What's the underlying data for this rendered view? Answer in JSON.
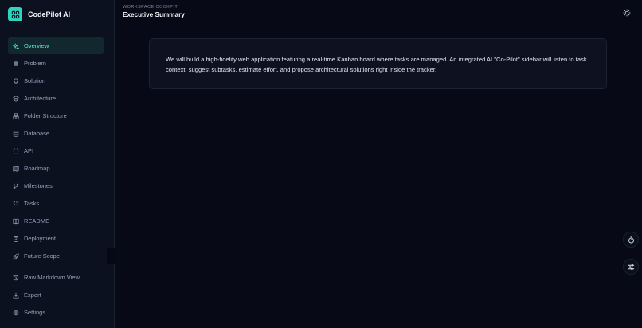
{
  "app": {
    "name": "CodePilot AI",
    "logo_icon": "grid-icon",
    "accent_color": "#2dd4bf"
  },
  "sidebar": {
    "items": [
      {
        "label": "Overview",
        "icon": "sparkles-icon",
        "active": true
      },
      {
        "label": "Problem",
        "icon": "circle-icon",
        "active": false
      },
      {
        "label": "Solution",
        "icon": "lightbulb-icon",
        "active": false
      },
      {
        "label": "Architecture",
        "icon": "layers-icon",
        "active": false
      },
      {
        "label": "Folder Structure",
        "icon": "boxes-icon",
        "active": false
      },
      {
        "label": "Database",
        "icon": "database-icon",
        "active": false
      },
      {
        "label": "API",
        "icon": "braces-icon",
        "active": false
      },
      {
        "label": "Roadmap",
        "icon": "map-icon",
        "active": false
      },
      {
        "label": "Milestones",
        "icon": "git-branch-icon",
        "active": false
      },
      {
        "label": "Tasks",
        "icon": "list-checks-icon",
        "active": false
      },
      {
        "label": "README",
        "icon": "book-icon",
        "active": false
      },
      {
        "label": "Deployment",
        "icon": "clipboard-icon",
        "active": false
      },
      {
        "label": "Future Scope",
        "icon": "rocket-icon",
        "active": false
      }
    ],
    "bottom_items": [
      {
        "label": "Raw Markdown View",
        "icon": "history-icon"
      },
      {
        "label": "Export",
        "icon": "download-icon"
      },
      {
        "label": "Settings",
        "icon": "gear-icon"
      }
    ]
  },
  "header": {
    "eyebrow": "WORKSPACE COCKPIT",
    "title": "Executive Summary",
    "theme_icon": "sun-icon"
  },
  "main": {
    "summary_text": "We will build a high-fidelity web application featuring a real-time Kanban board where tasks are managed. An integrated AI \"Co-Pilot\" sidebar will listen to task context, suggest subtasks, estimate effort, and propose architectural solutions right inside the tracker."
  },
  "floating_actions": [
    {
      "icon": "timer-icon"
    },
    {
      "icon": "sliders-icon"
    }
  ]
}
